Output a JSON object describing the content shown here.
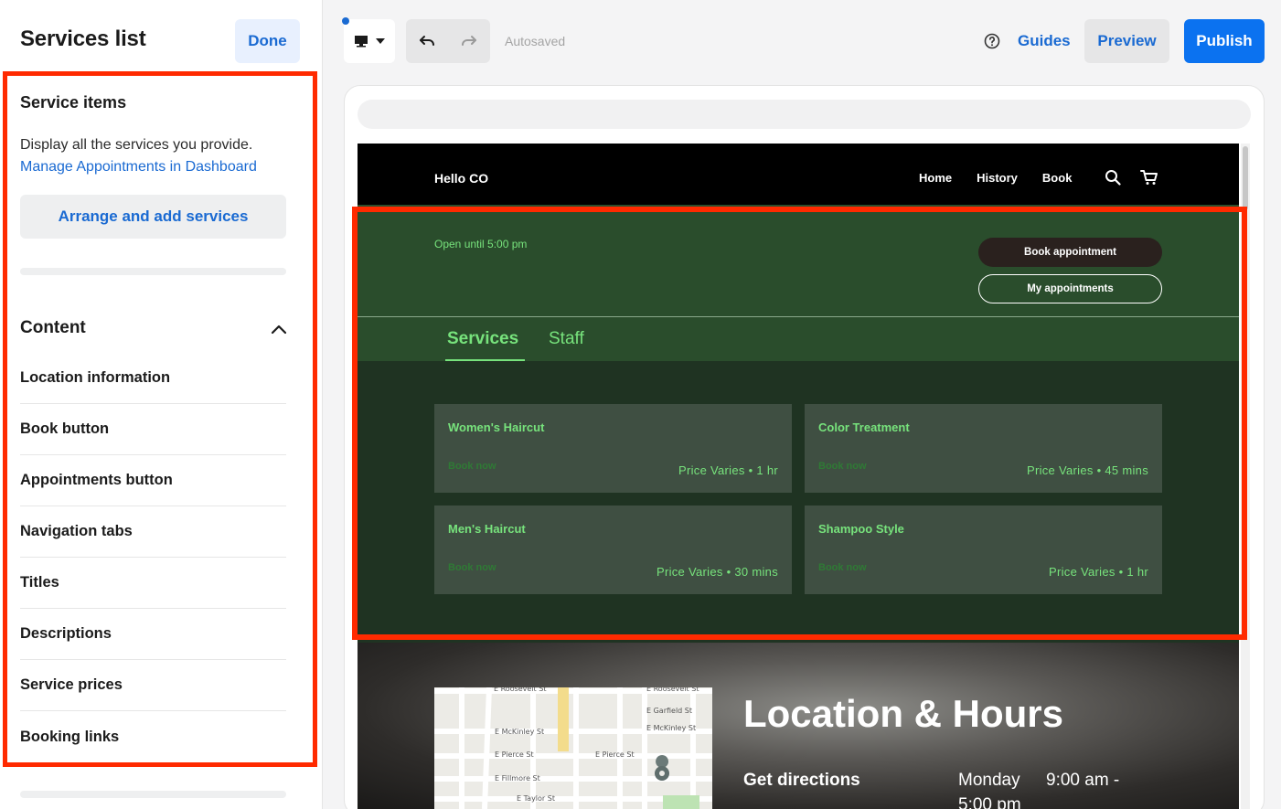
{
  "panel": {
    "title": "Services list",
    "done_label": "Done",
    "section_heading": "Service items",
    "description": "Display all the services you provide.",
    "dashboard_link": "Manage Appointments in Dashboard",
    "arrange_label": "Arrange and add services",
    "content_heading": "Content",
    "content_items": [
      "Location information",
      "Book button",
      "Appointments button",
      "Navigation tabs",
      "Titles",
      "Descriptions",
      "Service prices",
      "Booking links"
    ]
  },
  "toolbar": {
    "autosaved": "Autosaved",
    "guides": "Guides",
    "preview": "Preview",
    "publish": "Publish"
  },
  "site": {
    "brand": "Hello CO",
    "nav_links": [
      "Home",
      "History",
      "Book"
    ],
    "open_until": "Open until 5:00 pm",
    "book_appointment": "Book appointment",
    "my_appointments": "My appointments",
    "tabs": [
      "Services",
      "Staff"
    ],
    "services": [
      {
        "name": "Women's Haircut",
        "book": "Book now",
        "price": "Price Varies",
        "duration": "1 hr"
      },
      {
        "name": "Color Treatment",
        "book": "Book now",
        "price": "Price Varies",
        "duration": "45 mins"
      },
      {
        "name": "Men's Haircut",
        "book": "Book now",
        "price": "Price Varies",
        "duration": "30 mins"
      },
      {
        "name": "Shampoo Style",
        "book": "Book now",
        "price": "Price Varies",
        "duration": "1 hr"
      }
    ],
    "location": {
      "title": "Location & Hours",
      "directions": "Get directions",
      "day": "Monday",
      "hours_start": "9:00 am -",
      "hours_end": "5:00 pm"
    }
  },
  "colors": {
    "accent": "#1a6ad2",
    "publish": "#0b72f0",
    "highlight_outline": "#ff2a00",
    "site_green": "#2a4d2c",
    "site_text_green": "#77e37c"
  }
}
